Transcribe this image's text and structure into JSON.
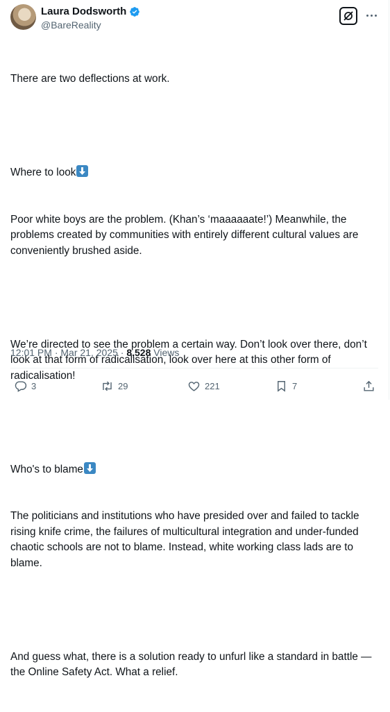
{
  "author": {
    "name": "Laura Dodsworth",
    "handle": "@BareReality"
  },
  "tweet": {
    "p1": "There are two deflections at work.",
    "p2a": "Where to look",
    "p2b": "Poor white boys are the problem. (Khan’s ‘maaaaaate!’) Meanwhile, the problems created by communities with entirely different cultural values are conveniently brushed aside.",
    "p3": "We’re directed to see the problem a certain way. Don’t look over there, don’t look at that form of radicalisation, look over here at this other form of radicalisation!",
    "p4a": "Who's to blame",
    "p4b": "The politicians and institutions who have presided over and failed to tackle rising knife crime, the failures of multicultural integration and under-funded chaotic schools are not to blame. Instead, white working class lads are to blame.",
    "p5": "And guess what, there is a solution ready to unfurl like a standard in battle — the Online Safety Act. What a relief."
  },
  "meta": {
    "time": "12:01 PM",
    "separator": "·",
    "date": "Mar 21, 2025",
    "dot": "·",
    "views_count": "8,528",
    "views_label": "Views"
  },
  "actions": {
    "replies": "3",
    "reposts": "29",
    "likes": "221",
    "bookmarks": "7"
  },
  "colors": {
    "accent": "#1d9bf0",
    "emoji_blue": "#3b88c3",
    "muted": "#536471"
  },
  "icons": [
    "verified-badge-icon",
    "grok-icon",
    "more-icon",
    "down-arrow-icon",
    "reply-icon",
    "repost-icon",
    "like-icon",
    "bookmark-icon",
    "share-icon"
  ]
}
